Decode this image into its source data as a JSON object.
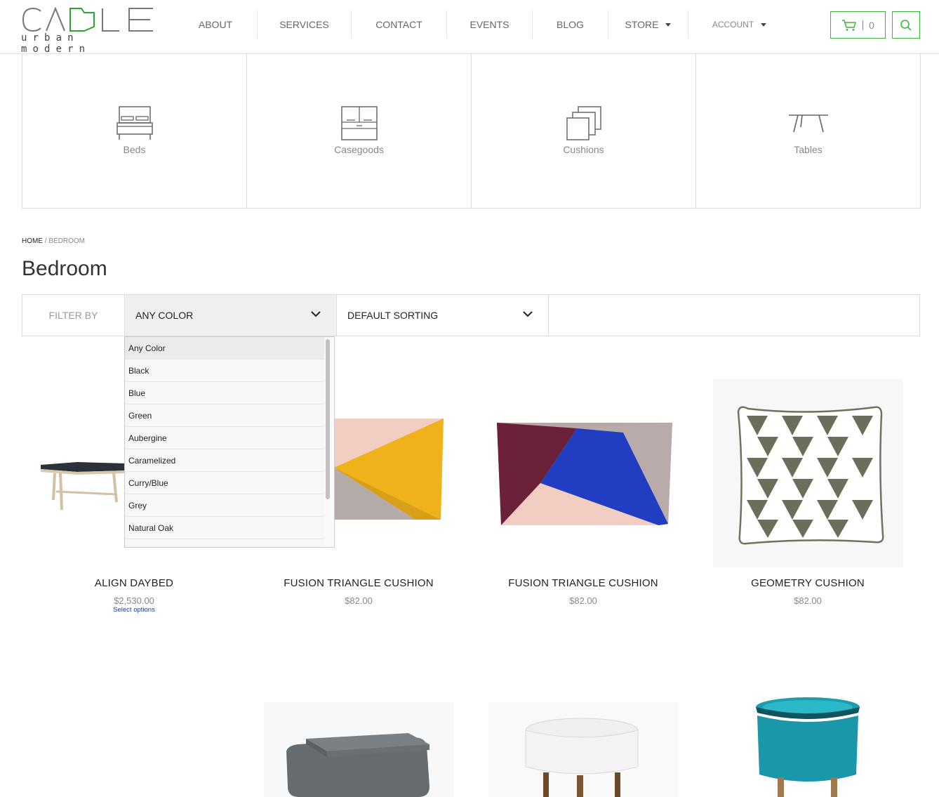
{
  "header": {
    "logo_text": "CABLE",
    "logo_sub": "urban modern",
    "nav": [
      {
        "label": "ABOUT"
      },
      {
        "label": "SERVICES"
      },
      {
        "label": "CONTACT"
      },
      {
        "label": "EVENTS"
      },
      {
        "label": "BLOG"
      },
      {
        "label": "STORE"
      },
      {
        "label": "ACCOUNT"
      }
    ],
    "cart_count": "0",
    "accent_color": "#3db53d"
  },
  "categories": [
    {
      "label": "Beds",
      "icon": "bed-icon"
    },
    {
      "label": "Casegoods",
      "icon": "cabinet-icon"
    },
    {
      "label": "Cushions",
      "icon": "cushions-icon"
    },
    {
      "label": "Tables",
      "icon": "table-icon"
    }
  ],
  "breadcrumb": {
    "home": "HOME",
    "sep": " / ",
    "current": "BEDROOM"
  },
  "page_title": "Bedroom",
  "filter": {
    "label": "FILTER BY",
    "color_selected": "ANY COLOR",
    "sort_selected": "DEFAULT SORTING",
    "color_options": [
      "Any Color",
      "Black",
      "Blue",
      "Green",
      "Aubergine",
      "Caramelized",
      "Curry/Blue",
      "Grey",
      "Natural Oak"
    ]
  },
  "products": [
    {
      "name": "ALIGN DAYBED",
      "price": "$2,530.00",
      "options": "Select options"
    },
    {
      "name": "FUSION TRIANGLE CUSHION",
      "price": "$82.00"
    },
    {
      "name": "FUSION TRIANGLE CUSHION",
      "price": "$82.00"
    },
    {
      "name": "GEOMETRY CUSHION",
      "price": "$82.00"
    }
  ]
}
